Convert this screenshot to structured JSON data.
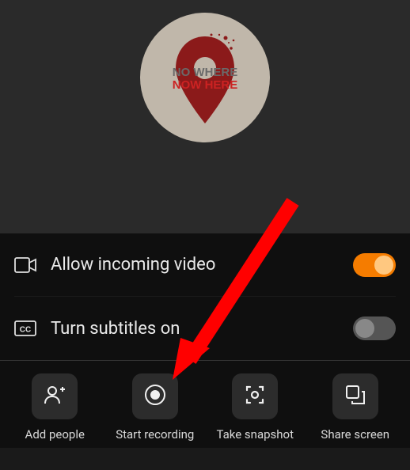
{
  "avatar": {
    "text_top": "NO WHERE",
    "text_bottom": "NOW HERE"
  },
  "settings": {
    "incoming_video": {
      "label": "Allow incoming video",
      "enabled": true
    },
    "subtitles": {
      "label": "Turn subtitles on",
      "enabled": false
    }
  },
  "actions": {
    "add_people": "Add people",
    "start_recording": "Start recording",
    "take_snapshot": "Take snapshot",
    "share_screen": "Share screen"
  },
  "annotation": {
    "arrow_target": "start-recording-button",
    "color": "#ff0000"
  }
}
